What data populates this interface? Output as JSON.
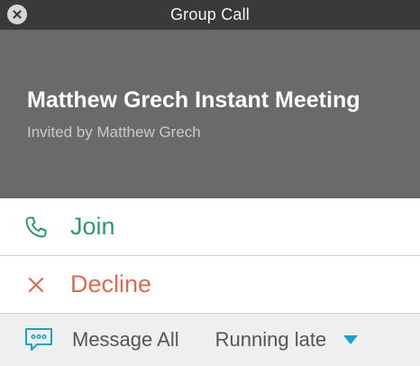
{
  "window": {
    "title": "Group Call"
  },
  "meeting": {
    "title": "Matthew Grech Instant Meeting",
    "invited_by": "Invited by Matthew Grech"
  },
  "actions": {
    "join_label": "Join",
    "decline_label": "Decline"
  },
  "footer": {
    "message_all_label": "Message All",
    "quick_reply_selected": "Running late"
  },
  "colors": {
    "join": "#2c9a6e",
    "decline": "#e06a50",
    "accent": "#19a3c4"
  },
  "icons": [
    "close-icon",
    "phone-icon",
    "x-icon",
    "chat-bubble-icon",
    "caret-down-icon"
  ]
}
